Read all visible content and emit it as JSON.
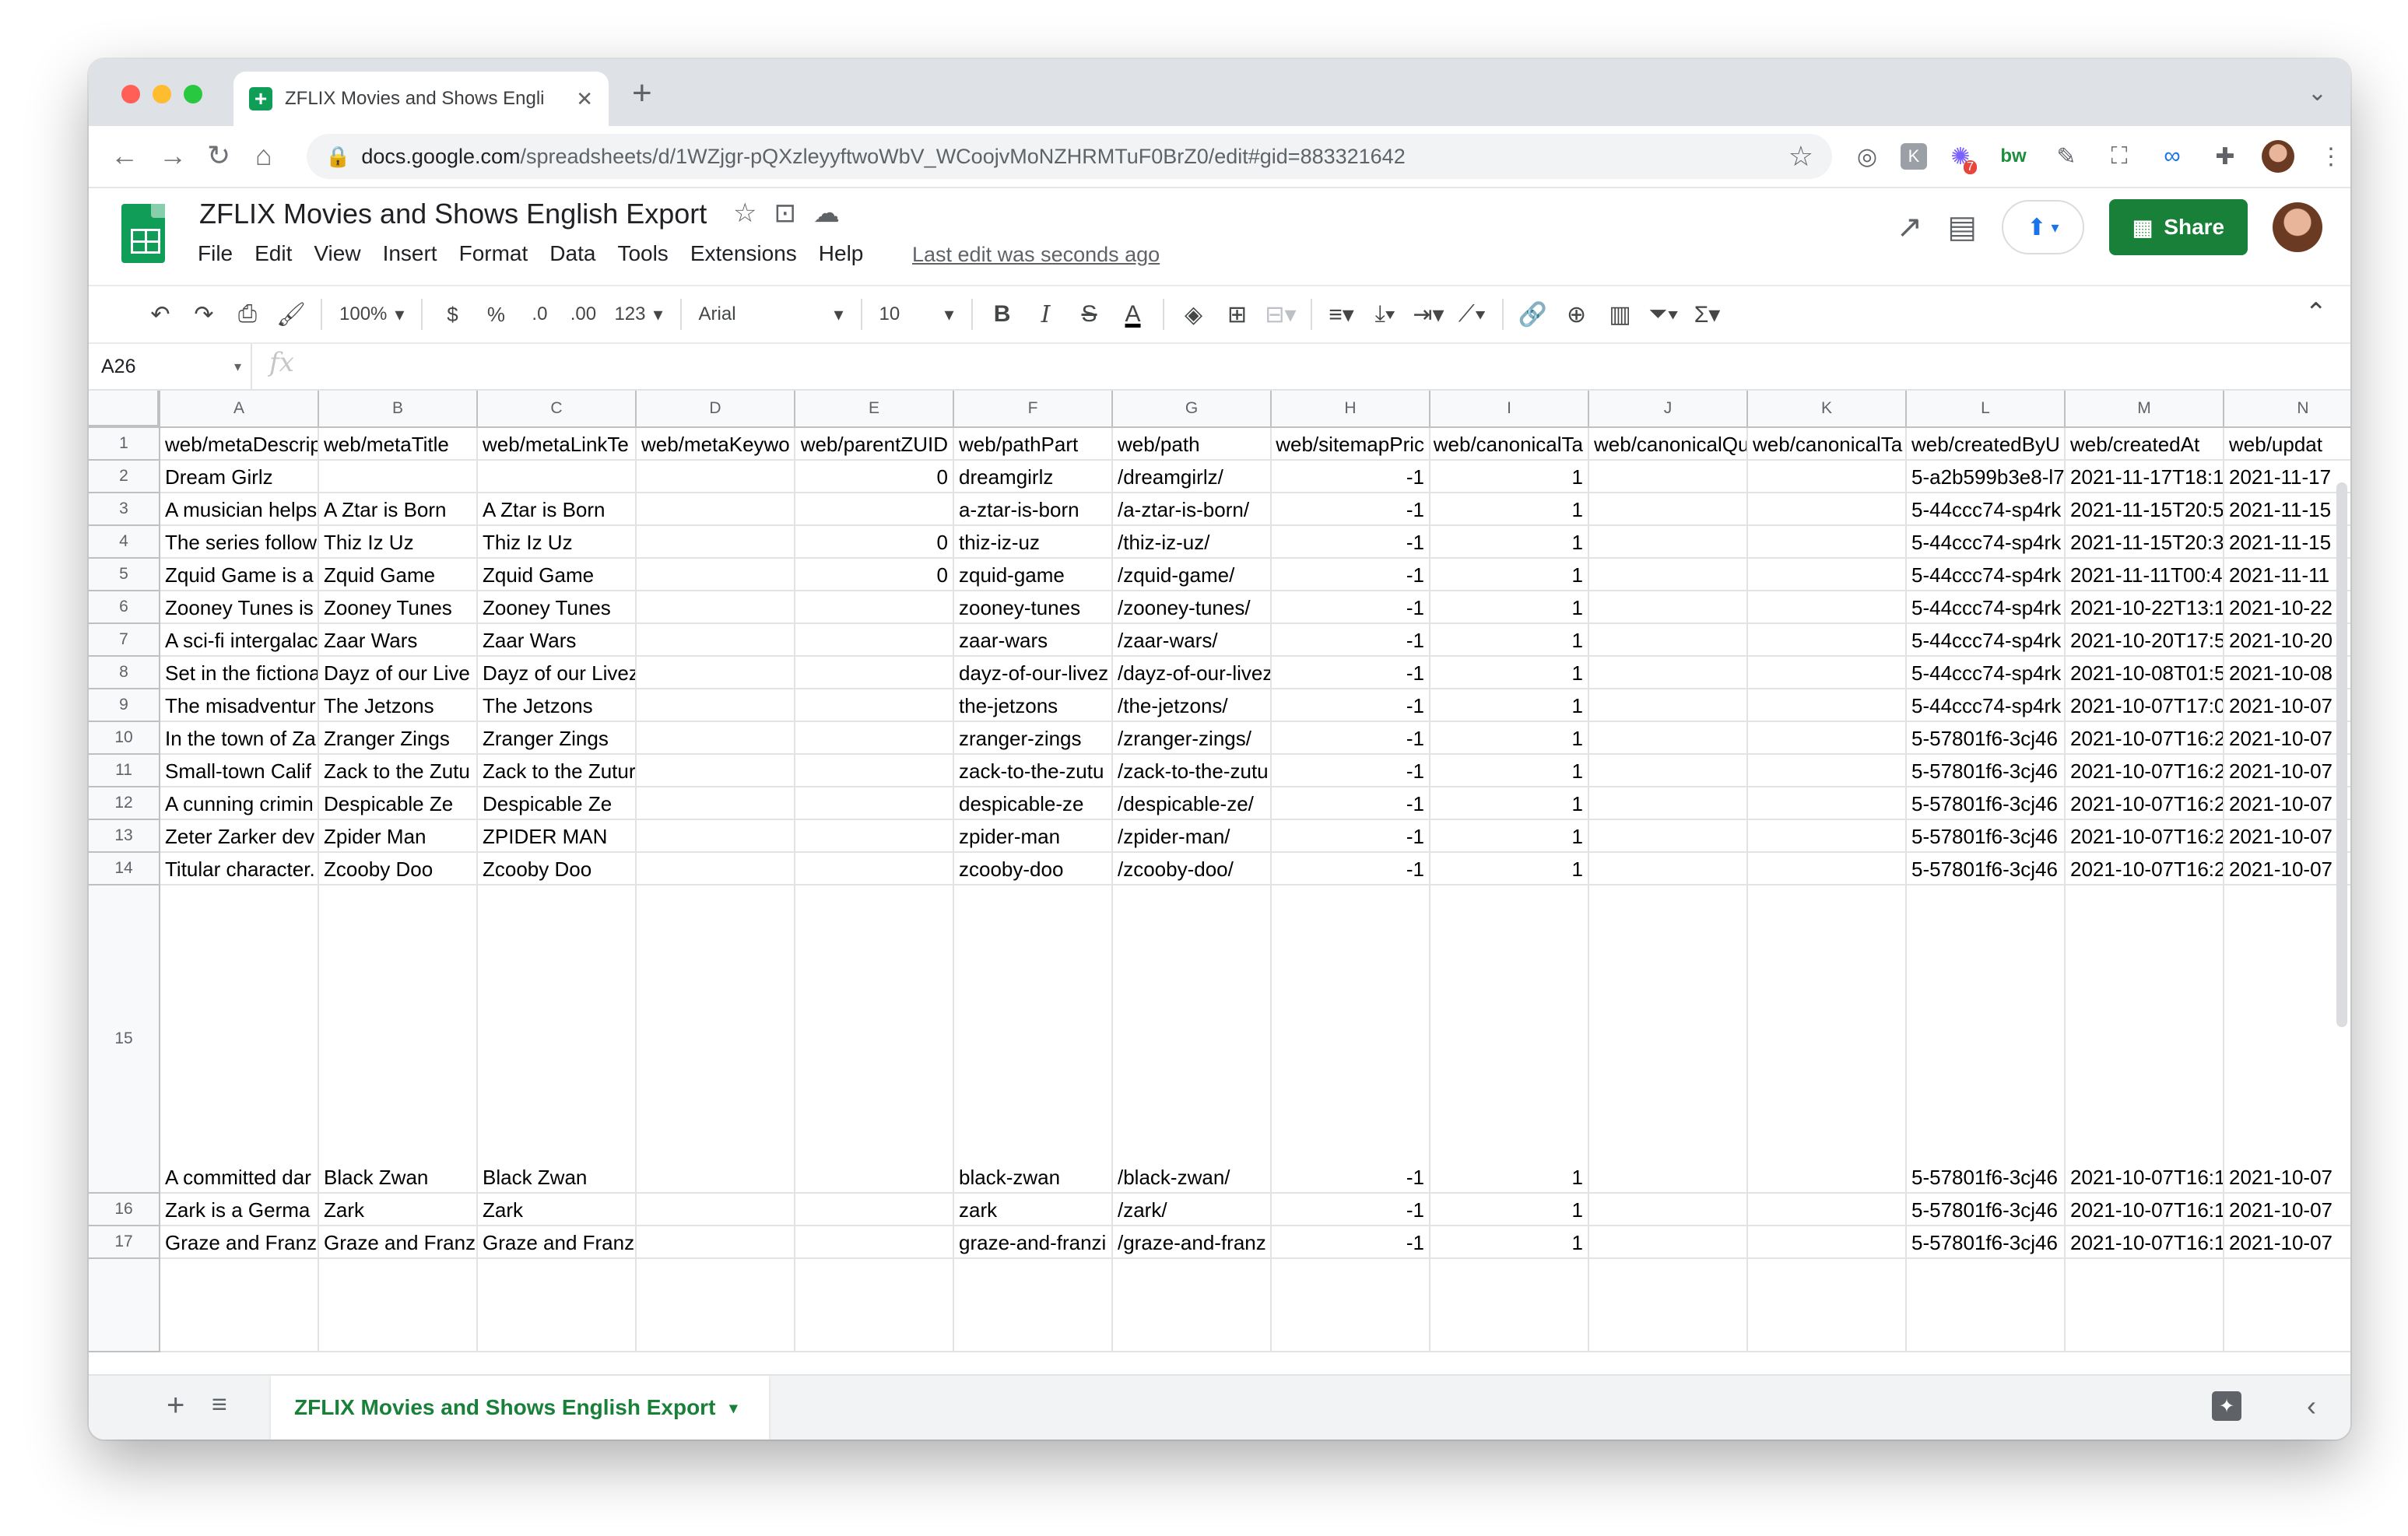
{
  "browser": {
    "tab_title": "ZFLIX Movies and Shows Engli",
    "url_host": "docs.google.com",
    "url_path": "/spreadsheets/d/1WZjgr-pQXzleyyftwoWbV_WCoojvMoNZHRMTuF0BrZ0/edit#gid=883321642",
    "ext_badge": "7"
  },
  "doc": {
    "title": "ZFLIX Movies and Shows English Export",
    "menu": [
      "File",
      "Edit",
      "View",
      "Insert",
      "Format",
      "Data",
      "Tools",
      "Extensions",
      "Help"
    ],
    "last_edit": "Last edit was seconds ago",
    "share_label": "Share"
  },
  "toolbar": {
    "zoom": "100%",
    "currency": "$",
    "percent": "%",
    "dec_decrease": ".0",
    "dec_increase": ".00",
    "more_formats": "123",
    "font": "Arial",
    "font_size": "10"
  },
  "formula_bar": {
    "name_box": "A26",
    "fx": "fx",
    "value": ""
  },
  "grid": {
    "columns": [
      "A",
      "B",
      "C",
      "D",
      "E",
      "F",
      "G",
      "H",
      "I",
      "J",
      "K",
      "L",
      "M",
      "N"
    ],
    "rows": [
      {
        "num": "1",
        "cells": [
          "web/metaDescrip",
          "web/metaTitle",
          "web/metaLinkTe",
          "web/metaKeywo",
          "web/parentZUID",
          "web/pathPart",
          "web/path",
          "web/sitemapPric",
          "web/canonicalTa",
          "web/canonicalQu",
          "web/canonicalTa",
          "web/createdByU",
          "web/createdAt",
          "web/updat"
        ]
      },
      {
        "num": "2",
        "cells": [
          "Dream Girlz",
          "",
          "",
          "",
          "0",
          "dreamgirlz",
          "/dreamgirlz/",
          "-1",
          "1",
          "",
          "",
          "5-a2b599b3e8-l7",
          "2021-11-17T18:1",
          "2021-11-17"
        ]
      },
      {
        "num": "3",
        "cells": [
          "A musician helps",
          "A Ztar is Born",
          "A Ztar is Born",
          "",
          "",
          "a-ztar-is-born",
          "/a-ztar-is-born/",
          "-1",
          "1",
          "",
          "",
          "5-44ccc74-sp4rk",
          "2021-11-15T20:5",
          "2021-11-15"
        ]
      },
      {
        "num": "4",
        "cells": [
          "The series follow",
          "Thiz Iz Uz",
          "Thiz Iz Uz",
          "",
          "0",
          "thiz-iz-uz",
          "/thiz-iz-uz/",
          "-1",
          "1",
          "",
          "",
          "5-44ccc74-sp4rk",
          "2021-11-15T20:3",
          "2021-11-15"
        ]
      },
      {
        "num": "5",
        "cells": [
          "Zquid Game is a",
          "Zquid Game",
          "Zquid Game",
          "",
          "0",
          "zquid-game",
          "/zquid-game/",
          "-1",
          "1",
          "",
          "",
          "5-44ccc74-sp4rk",
          "2021-11-11T00:4",
          "2021-11-11"
        ]
      },
      {
        "num": "6",
        "cells": [
          "Zooney Tunes is",
          "Zooney Tunes",
          "Zooney Tunes",
          "",
          "",
          "zooney-tunes",
          "/zooney-tunes/",
          "-1",
          "1",
          "",
          "",
          "5-44ccc74-sp4rk",
          "2021-10-22T13:1",
          "2021-10-22"
        ]
      },
      {
        "num": "7",
        "cells": [
          "A sci-fi intergalac",
          "Zaar Wars",
          "Zaar Wars",
          "",
          "",
          "zaar-wars",
          "/zaar-wars/",
          "-1",
          "1",
          "",
          "",
          "5-44ccc74-sp4rk",
          "2021-10-20T17:5",
          "2021-10-20"
        ]
      },
      {
        "num": "8",
        "cells": [
          "Set in the fictiona",
          "Dayz of our Live",
          "Dayz of our Livez",
          "",
          "",
          "dayz-of-our-livez",
          "/dayz-of-our-livez",
          "-1",
          "1",
          "",
          "",
          "5-44ccc74-sp4rk",
          "2021-10-08T01:5",
          "2021-10-08"
        ]
      },
      {
        "num": "9",
        "cells": [
          "The misadventur",
          "The Jetzons",
          "The Jetzons",
          "",
          "",
          "the-jetzons",
          "/the-jetzons/",
          "-1",
          "1",
          "",
          "",
          "5-44ccc74-sp4rk",
          "2021-10-07T17:0",
          "2021-10-07"
        ]
      },
      {
        "num": "10",
        "cells": [
          "In the town of Za",
          "Zranger Zings",
          "Zranger Zings",
          "",
          "",
          "zranger-zings",
          "/zranger-zings/",
          "-1",
          "1",
          "",
          "",
          "5-57801f6-3cj46",
          "2021-10-07T16:2",
          "2021-10-07"
        ]
      },
      {
        "num": "11",
        "cells": [
          "Small-town Calif",
          "Zack to the Zutu",
          "Zack to the Zuture",
          "",
          "",
          "zack-to-the-zutu",
          "/zack-to-the-zutu",
          "-1",
          "1",
          "",
          "",
          "5-57801f6-3cj46",
          "2021-10-07T16:2",
          "2021-10-07"
        ]
      },
      {
        "num": "12",
        "cells": [
          "A cunning crimin",
          "Despicable Ze",
          "Despicable Ze",
          "",
          "",
          "despicable-ze",
          "/despicable-ze/",
          "-1",
          "1",
          "",
          "",
          "5-57801f6-3cj46",
          "2021-10-07T16:2",
          "2021-10-07"
        ]
      },
      {
        "num": "13",
        "cells": [
          "Zeter Zarker dev",
          "Zpider Man",
          "ZPIDER MAN",
          "",
          "",
          "zpider-man",
          "/zpider-man/",
          "-1",
          "1",
          "",
          "",
          "5-57801f6-3cj46",
          "2021-10-07T16:2",
          "2021-10-07"
        ]
      },
      {
        "num": "14",
        "cells": [
          "Titular character.",
          "Zcooby Doo",
          "Zcooby Doo",
          "",
          "",
          "zcooby-doo",
          "/zcooby-doo/",
          "-1",
          "1",
          "",
          "",
          "5-57801f6-3cj46",
          "2021-10-07T16:2",
          "2021-10-07"
        ]
      },
      {
        "num": "15",
        "cells": [
          "A committed dar",
          "Black Zwan",
          "Black Zwan",
          "",
          "",
          "black-zwan",
          "/black-zwan/",
          "-1",
          "1",
          "",
          "",
          "5-57801f6-3cj46",
          "2021-10-07T16:1",
          "2021-10-07"
        ]
      },
      {
        "num": "16",
        "cells": [
          "Zark is a Germa",
          "Zark",
          "Zark",
          "",
          "",
          "zark",
          "/zark/",
          "-1",
          "1",
          "",
          "",
          "5-57801f6-3cj46",
          "2021-10-07T16:1",
          "2021-10-07"
        ]
      },
      {
        "num": "17",
        "cells": [
          "Graze and Franz",
          "Graze and Franz",
          "Graze and Franzine",
          "",
          "",
          "graze-and-franzi",
          "/graze-and-franz",
          "-1",
          "1",
          "",
          "",
          "5-57801f6-3cj46",
          "2021-10-07T16:1",
          "2021-10-07"
        ]
      },
      {
        "num": "",
        "cells": [
          "",
          "",
          "",
          "",
          "",
          "",
          "",
          "",
          "",
          "",
          "",
          "",
          "",
          ""
        ]
      }
    ]
  },
  "sheet_tabs": {
    "active": "ZFLIX Movies and Shows English Export"
  },
  "colors": {
    "share_green": "#188038",
    "sheet_tab_text": "#188038",
    "accent_blue": "#1a73e8"
  }
}
